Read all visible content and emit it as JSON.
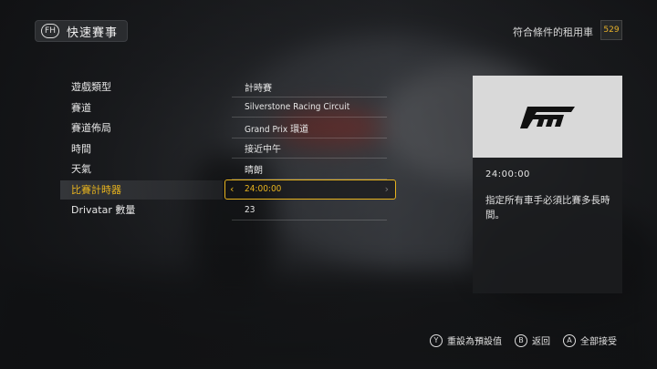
{
  "header": {
    "title": "快速賽事",
    "count_label": "符合條件的租用車",
    "count": "529"
  },
  "settings": [
    {
      "label": "遊戲類型",
      "value": "計時賽"
    },
    {
      "label": "賽道",
      "value": "Silverstone Racing Circuit"
    },
    {
      "label": "賽道佈局",
      "value": "Grand Prix 環道"
    },
    {
      "label": "時間",
      "value": "接近中午"
    },
    {
      "label": "天氣",
      "value": "晴朗"
    },
    {
      "label": "比賽計時器",
      "value": "24:00:00",
      "selected": true
    },
    {
      "label": "Drivatar 數量",
      "value": "23"
    }
  ],
  "panel": {
    "time": "24:00:00",
    "description": "指定所有車手必須比賽多長時間。"
  },
  "footer": [
    {
      "button": "Y",
      "label": "重設為預設值"
    },
    {
      "button": "B",
      "label": "返回"
    },
    {
      "button": "A",
      "label": "全部接受"
    }
  ],
  "colors": {
    "accent": "#e8b41e"
  }
}
